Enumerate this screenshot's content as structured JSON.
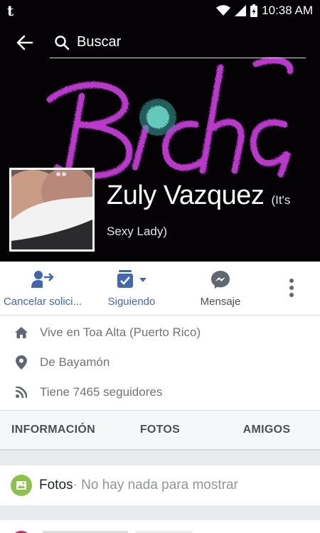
{
  "status_bar": {
    "app_icon_letter": "t",
    "time": "10:38 AM",
    "icons": [
      "wifi-icon",
      "signal-icon",
      "battery-charging-icon"
    ]
  },
  "search": {
    "placeholder": "Buscar"
  },
  "cover": {
    "graffiti_text": "Bicha"
  },
  "profile": {
    "name": "Zuly Vazquez",
    "nickname_part1": "(It's",
    "nickname_part2": "Sexy Lady)"
  },
  "actions": {
    "cancel_request": "Cancelar solici...",
    "following": "Siguiendo",
    "message": "Mensaje"
  },
  "info": {
    "lives_in": "Vive en Toa Alta (Puerto Rico)",
    "from": "De Bayamón",
    "followers": "Tiene 7465 seguidores"
  },
  "tabs": {
    "info": "INFORMACIÓN",
    "photos": "FOTOS",
    "friends": "AMIGOS"
  },
  "photos_section": {
    "title": "Fotos",
    "empty_text": " · No hay nada para mostrar"
  },
  "colors": {
    "accent": "#4267b2",
    "cover_bg": "#050205",
    "graffiti": "#c43ad6",
    "graffiti_dot": "#5fd3c9",
    "icon_gray": "#616770",
    "photos_icon": "#8bc34a",
    "next_icon": "#e91e63"
  }
}
